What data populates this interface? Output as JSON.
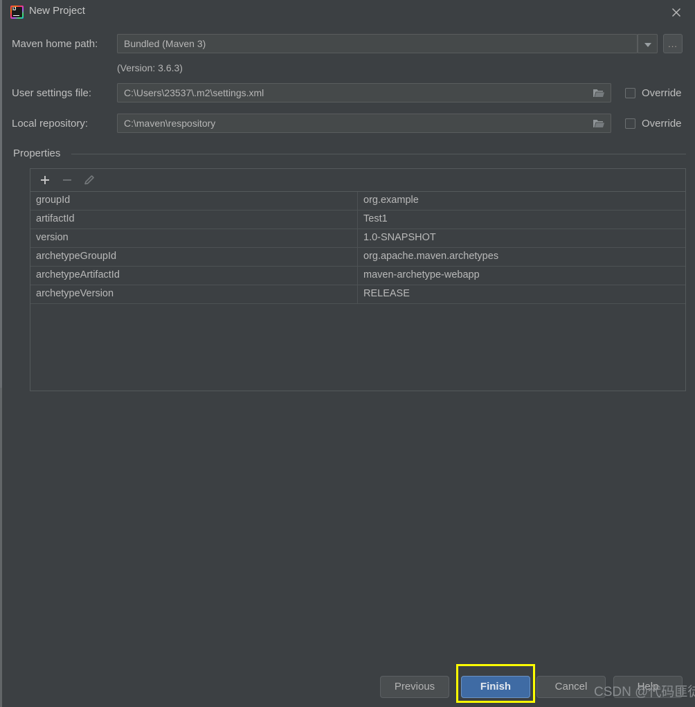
{
  "window": {
    "title": "New Project",
    "app_icon": "intellij-idea-icon",
    "close_icon": "close-icon"
  },
  "form": {
    "maven_home": {
      "label": "Maven home path:",
      "value": "Bundled (Maven 3)",
      "dropdown_icon": "chevron-down-icon",
      "browse_label": "...",
      "version_note": "(Version: 3.6.3)"
    },
    "user_settings": {
      "label": "User settings file:",
      "value": "C:\\Users\\23537\\.m2\\settings.xml",
      "folder_icon": "folder-icon",
      "override_label": "Override",
      "override_checked": false
    },
    "local_repository": {
      "label": "Local repository:",
      "value": "C:\\maven\\respository",
      "folder_icon": "folder-icon",
      "override_label": "Override",
      "override_checked": false
    }
  },
  "properties": {
    "group_label": "Properties",
    "toolbar": {
      "add_icon": "plus-icon",
      "remove_icon": "minus-icon",
      "edit_icon": "pencil-icon"
    },
    "rows": [
      {
        "key": "groupId",
        "value": "org.example"
      },
      {
        "key": "artifactId",
        "value": "Test1"
      },
      {
        "key": "version",
        "value": "1.0-SNAPSHOT"
      },
      {
        "key": "archetypeGroupId",
        "value": "org.apache.maven.archetypes"
      },
      {
        "key": "archetypeArtifactId",
        "value": "maven-archetype-webapp"
      },
      {
        "key": "archetypeVersion",
        "value": "RELEASE"
      }
    ]
  },
  "footer": {
    "previous_label": "Previous",
    "finish_label": "Finish",
    "cancel_label": "Cancel",
    "help_label": "Help"
  },
  "annotation": {
    "highlight_color": "#ffff00",
    "watermark": "CSDN @代码匪徒"
  },
  "colors": {
    "background": "#3c4043",
    "field_background": "#45494a",
    "border": "#555a5c",
    "text": "#bfbfbf",
    "primary_button": "#3f6ba4"
  }
}
